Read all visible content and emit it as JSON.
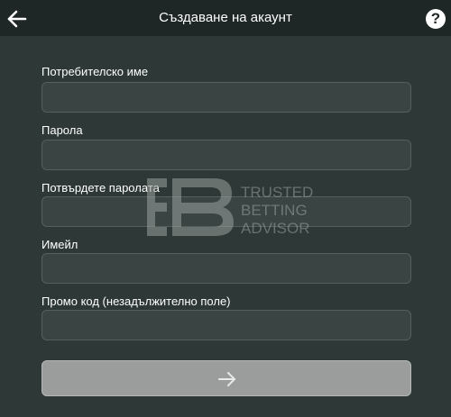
{
  "header": {
    "title": "Създаване на акаунт",
    "back_icon": "arrow-left-icon",
    "help_icon": "question-mark-icon",
    "help_glyph": "?"
  },
  "form": {
    "fields": [
      {
        "label": "Потребителско име",
        "value": "",
        "type": "text"
      },
      {
        "label": "Парола",
        "value": "",
        "type": "password"
      },
      {
        "label": "Потвърдете паролата",
        "value": "",
        "type": "password"
      },
      {
        "label": "Имейл",
        "value": "",
        "type": "email"
      },
      {
        "label": "Промо код (незадължително поле)",
        "value": "",
        "type": "text"
      }
    ],
    "submit_icon": "arrow-right-icon"
  },
  "watermark": {
    "text": [
      "TRUSTED",
      "BETTING",
      "ADVISOR"
    ]
  },
  "colors": {
    "background": "#2e3836",
    "header": "#1e2726",
    "input_bg": "#3a4543",
    "submit_bg": "#9a9d9c"
  }
}
